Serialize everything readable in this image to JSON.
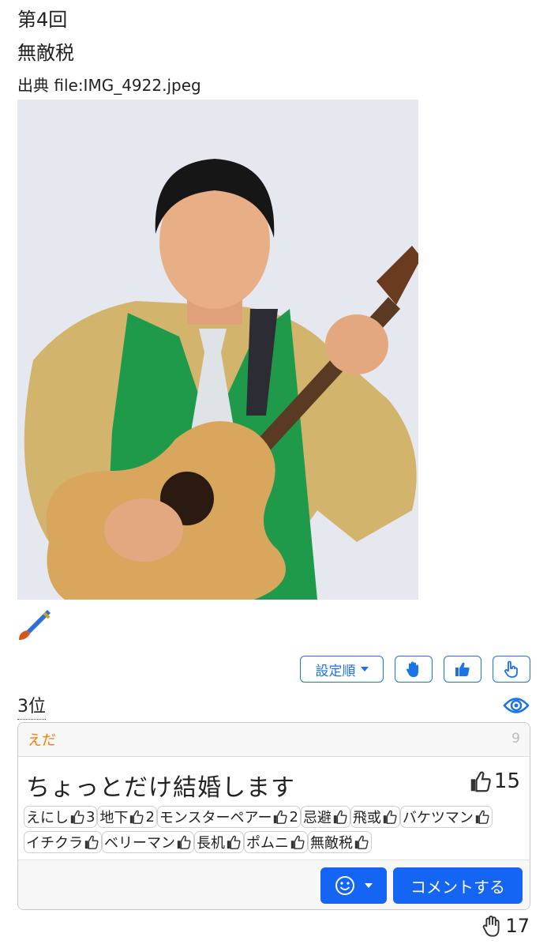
{
  "header": {
    "round": "第4回",
    "title": "無敵税",
    "source": "出典 file:IMG_4922.jpeg"
  },
  "image": {
    "description": "man in green vest holding acoustic guitar",
    "brush_icon": "paintbrush-icon"
  },
  "toolbar": {
    "sort_label": "設定順",
    "icons": [
      "raised-hand-icon",
      "thumbs-up-icon",
      "pointing-hand-icon"
    ]
  },
  "result": {
    "rank": "3位",
    "eye_icon": "eye-icon",
    "author": "えだ",
    "number": "9",
    "answer": "ちょっとだけ結婚します",
    "likes": "15",
    "voters": [
      {
        "name": "えにし",
        "count": "3"
      },
      {
        "name": "地下",
        "count": "2"
      },
      {
        "name": "モンスターペアー",
        "count": "2"
      },
      {
        "name": "忌避",
        "count": ""
      },
      {
        "name": "飛或",
        "count": ""
      },
      {
        "name": "バケツマン",
        "count": ""
      },
      {
        "name": "イチクラ",
        "count": ""
      },
      {
        "name": "ベリーマン",
        "count": ""
      },
      {
        "name": "長机",
        "count": ""
      },
      {
        "name": "ポムニ",
        "count": ""
      },
      {
        "name": "無敵税",
        "count": ""
      }
    ],
    "comment_label": "コメントする",
    "hand_count": "17"
  },
  "colors": {
    "accent": "#1565f5",
    "author": "#ff7a00"
  }
}
